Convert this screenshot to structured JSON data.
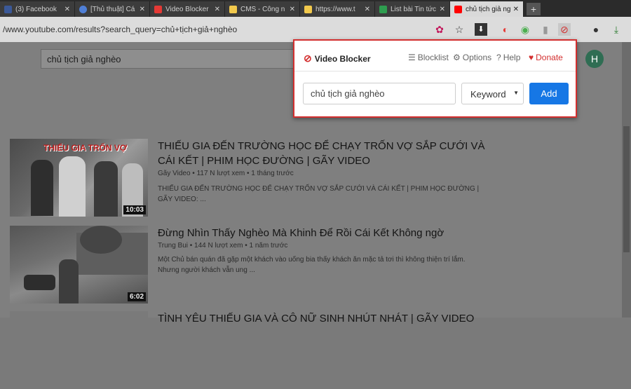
{
  "tabs": [
    {
      "title": "(3) Facebook",
      "color": "#3b5998"
    },
    {
      "title": "[Thủ thuật] Cá",
      "color": "#4f7fd6"
    },
    {
      "title": "Video Blocker",
      "color": "#e53935"
    },
    {
      "title": "CMS - Công n",
      "color": "#f2c94c"
    },
    {
      "title": "https://www.t",
      "color": "#f2c94c"
    },
    {
      "title": "List bài Tin tức",
      "color": "#2e9d4f"
    },
    {
      "title": "chủ tịch giả ng",
      "color": "#ff0000"
    }
  ],
  "tab_close": "✕",
  "new_tab": "+",
  "url": "/www.youtube.com/results?search_query=chủ+tịch+giả+nghèo",
  "yt": {
    "search_value": "chủ tịch giả nghèo",
    "avatar_letter": "H"
  },
  "popup": {
    "brand": "Video Blocker",
    "blocklist": "Blocklist",
    "options": "Options",
    "help": "Help",
    "donate": "Donate",
    "input_value": "chủ tịch giả nghèo",
    "select_value": "Keyword",
    "add_label": "Add"
  },
  "videos": [
    {
      "title": "THIẾU GIA ĐẾN TRƯỜNG HỌC ĐỂ CHẠY TRỐN VỢ SẮP CƯỚI VÀ CÁI KẾT | PHIM HỌC ĐƯỜNG | GÃY VIDEO",
      "meta": "Gãy Video • 117 N lượt xem • 1 tháng trước",
      "desc": "THIẾU GIA ĐẾN TRƯỜNG HỌC ĐỂ CHẠY TRỐN VỢ SẮP CƯỚI VÀ CÁI KẾT | PHIM HỌC ĐƯỜNG | GÃY VIDEO: ...",
      "thumb_text": "THIẾU GIA TRỐN VỢ",
      "duration": "10:03"
    },
    {
      "title": "Đừng Nhìn Thấy Nghèo Mà Khinh Để Rồi Cái Kết Không ngờ",
      "meta": "Trung Bui • 144 N lượt xem • 1 năm trước",
      "desc": "Một Chủ bán quán đã gặp một khách vào uống bia thấy khách ăn mặc tả tơi thì không thiện trí lắm. Nhưng người khách vẫn ung ...",
      "duration": "6:02"
    },
    {
      "title": "TÌNH YÊU THIẾU GIA VÀ CÔ NỮ SINH NHÚT NHÁT | GÃY VIDEO"
    }
  ]
}
